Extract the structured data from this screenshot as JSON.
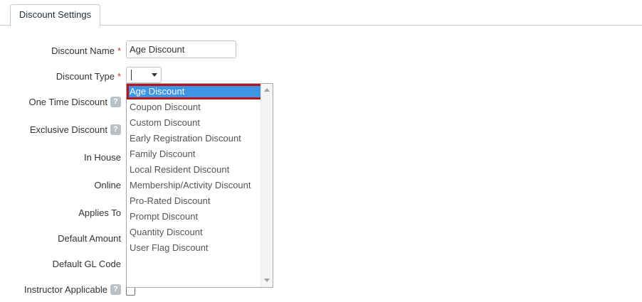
{
  "tabs": [
    {
      "label": "Discount Settings"
    }
  ],
  "form": {
    "discount_name": {
      "label": "Discount Name",
      "required_mark": "*",
      "value": "Age Discount"
    },
    "discount_type": {
      "label": "Discount Type",
      "required_mark": "*",
      "value": ""
    },
    "one_time_discount": {
      "label": "One Time Discount",
      "help": "?"
    },
    "exclusive_discount": {
      "label": "Exclusive Discount",
      "help": "?"
    },
    "in_house": {
      "label": "In House"
    },
    "online": {
      "label": "Online"
    },
    "applies_to": {
      "label": "Applies To"
    },
    "default_amount": {
      "label": "Default Amount"
    },
    "default_gl_code": {
      "label": "Default GL Code"
    },
    "instructor_applicable": {
      "label": "Instructor Applicable",
      "help": "?"
    }
  },
  "dropdown": {
    "selected_index": 0,
    "options": [
      "Age Discount",
      "Coupon Discount",
      "Custom Discount",
      "Early Registration Discount",
      "Family Discount",
      "Local Resident Discount",
      "Membership/Activity Discount",
      "Pro-Rated Discount",
      "Prompt Discount",
      "Quantity Discount",
      "User Flag Discount"
    ]
  },
  "colors": {
    "highlight": "#3d95e6",
    "highlight_border": "#b5141f",
    "required": "#c0392b"
  },
  "icons": {
    "help": "question-mark-icon",
    "select_arrow": "chevron-down-icon"
  }
}
